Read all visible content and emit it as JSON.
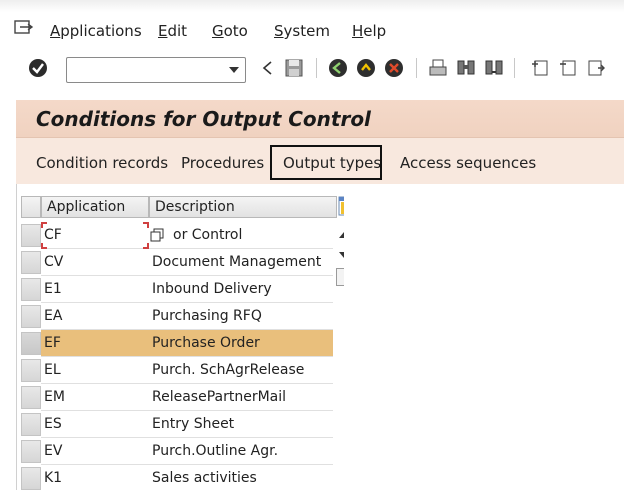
{
  "menu": {
    "items": [
      "Applications",
      "Edit",
      "Goto",
      "System",
      "Help"
    ]
  },
  "title": "Conditions for Output Control",
  "app_toolbar": {
    "buttons": [
      "Condition records",
      "Procedures",
      "Output types",
      "Access sequences"
    ],
    "highlighted": "Output types"
  },
  "grid": {
    "columns": [
      "Application",
      "Description"
    ],
    "rows": [
      {
        "app": "CF",
        "desc": "or Control"
      },
      {
        "app": "CV",
        "desc": "Document Management"
      },
      {
        "app": "E1",
        "desc": "Inbound Delivery"
      },
      {
        "app": "EA",
        "desc": "Purchasing RFQ"
      },
      {
        "app": "EF",
        "desc": "Purchase Order",
        "selected": true
      },
      {
        "app": "EL",
        "desc": "Purch. SchAgrRelease"
      },
      {
        "app": "EM",
        "desc": "ReleasePartnerMail"
      },
      {
        "app": "ES",
        "desc": "Entry Sheet"
      },
      {
        "app": "EV",
        "desc": "Purch.Outline Agr."
      },
      {
        "app": "K1",
        "desc": "Sales activities"
      }
    ]
  },
  "colors": {
    "title_bg": "#f4d9c9",
    "app_toolbar_bg": "#f8e8de",
    "selected_row": "#e9bf7c"
  },
  "icons": [
    "menu-icon",
    "enter-icon",
    "back-icon",
    "save-icon",
    "back-green-icon",
    "exit-icon",
    "cancel-icon",
    "print-icon",
    "find-icon",
    "find-next-icon",
    "first-page-icon",
    "prev-page-icon",
    "next-page-icon",
    "column-settings-icon",
    "copy-icon"
  ]
}
